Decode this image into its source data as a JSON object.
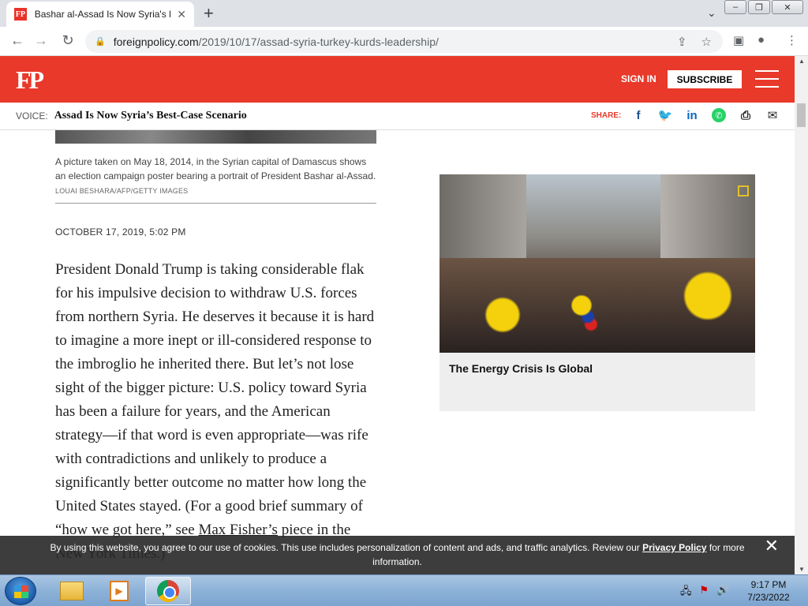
{
  "browser": {
    "tab_title": "Bashar al-Assad Is Now Syria's Best-Case Scenario",
    "tab_favicon": "FP",
    "tab_close": "✕",
    "new_tab": "+",
    "url_host": "foreignpolicy.com",
    "url_path": "/2019/10/17/assad-syria-turkey-kurds-leadership/"
  },
  "site": {
    "logo": "FP",
    "sign_in": "SIGN IN",
    "subscribe": "SUBSCRIBE",
    "brand_color": "#e8392a"
  },
  "voice_bar": {
    "label": "VOICE:",
    "title": "Assad Is Now Syria’s Best-Case Scenario",
    "share_label": "SHARE:",
    "share_icons": [
      "facebook-icon",
      "twitter-icon",
      "linkedin-icon",
      "whatsapp-icon",
      "print-icon",
      "email-icon"
    ]
  },
  "article": {
    "caption": "A picture taken on May 18, 2014, in the Syrian capital of Damascus shows an election campaign poster bearing a portrait of President Bashar al-Assad.",
    "credit": "LOUAI BESHARA/AFP/GETTY IMAGES",
    "date": "OCTOBER 17, 2019, 5:02 PM",
    "body_before_link": "President Donald Trump is taking considerable flak for his impulsive decision to withdraw U.S. forces from northern Syria. He deserves it because it is hard to imagine a more inept or ill-considered response to the imbroglio he inherited there. But let’s not lose sight of the bigger picture: U.S. policy toward Syria has been a failure for years, and the American strategy—if that word is even appropriate—was rife with contradictions and unlikely to produce a significantly better outcome no matter how long the United States stayed. (For a good brief summary of “how we got here,” see ",
    "body_link": "Max Fisher’s",
    "body_after_link": " piece in the New York Times.)"
  },
  "promo": {
    "title": "The Energy Crisis Is Global"
  },
  "cookie_banner": {
    "text_before": "By using this website, you agree to our use of cookies. This use includes personalization of content and ads, and traffic analytics. Review our ",
    "link": "Privacy Policy",
    "text_after": " for more information.",
    "close": "✕"
  },
  "taskbar": {
    "time": "9:17 PM",
    "date": "7/23/2022"
  }
}
